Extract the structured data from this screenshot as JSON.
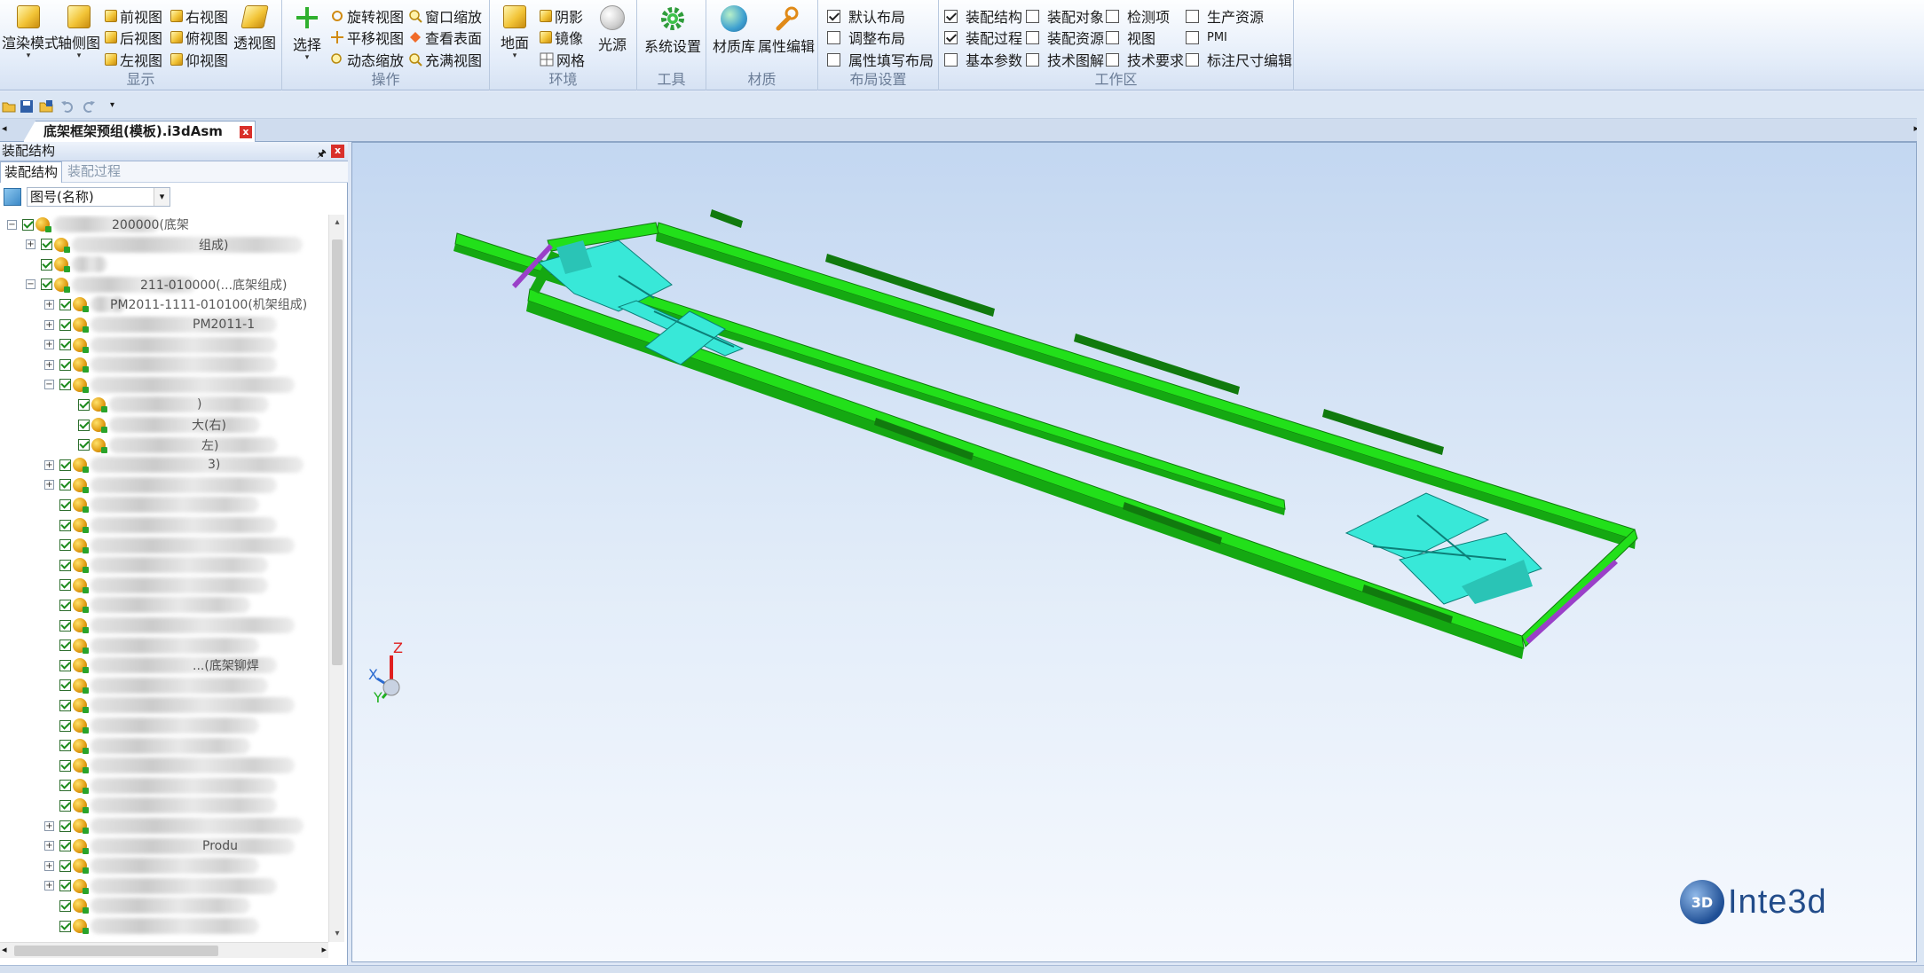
{
  "ribbon": {
    "display": {
      "label": "显示",
      "render_mode": "渲染模式",
      "axis_view": "轴侧图",
      "front_view": "前视图",
      "back_view": "后视图",
      "left_view": "左视图",
      "right_view": "右视图",
      "top_view": "俯视图",
      "bottom_view": "仰视图",
      "perspective_view": "透视图"
    },
    "operation": {
      "label": "操作",
      "select": "选择",
      "rotate_view": "旋转视图",
      "pan_view": "平移视图",
      "dynamic_zoom": "动态缩放",
      "window_zoom": "窗口缩放",
      "view_surface": "查看表面",
      "fit_view": "充满视图"
    },
    "environment": {
      "label": "环境",
      "ground": "地面",
      "shadow": "阴影",
      "mirror": "镜像",
      "grid": "网格",
      "light": "光源"
    },
    "tools": {
      "label": "工具",
      "system_settings": "系统设置"
    },
    "material": {
      "label": "材质",
      "material_library": "材质库",
      "property_editor": "属性编辑"
    },
    "layout": {
      "label": "布局设置",
      "items": [
        {
          "label": "默认布局",
          "checked": true
        },
        {
          "label": "调整布局",
          "checked": false
        },
        {
          "label": "属性填写布局",
          "checked": false
        }
      ]
    },
    "workspace": {
      "label": "工作区",
      "col1": [
        {
          "label": "装配结构",
          "checked": true
        },
        {
          "label": "装配过程",
          "checked": true
        },
        {
          "label": "基本参数",
          "checked": false
        }
      ],
      "col2": [
        {
          "label": "装配对象",
          "checked": false
        },
        {
          "label": "装配资源",
          "checked": false
        },
        {
          "label": "技术图解",
          "checked": false
        }
      ],
      "col3": [
        {
          "label": "检测项",
          "checked": false
        },
        {
          "label": "视图",
          "checked": false
        },
        {
          "label": "技术要求",
          "checked": false
        }
      ],
      "col4": [
        {
          "label": "生产资源",
          "checked": false
        },
        {
          "label": "PMI",
          "checked": false
        },
        {
          "label": "标注尺寸编辑",
          "checked": false
        }
      ]
    }
  },
  "doc_tab": {
    "title": "底架框架预组(模板).i3dAsm",
    "close": "x"
  },
  "panel": {
    "title": "装配结构",
    "pin": "ᵖ",
    "close": "x",
    "tabs": [
      "装配结构",
      "装配过程"
    ],
    "filter_value": "图号(名称)",
    "tree_visible": [
      {
        "row": 0,
        "text": "200000(底架"
      },
      {
        "row": 1,
        "text": "组成)"
      },
      {
        "row": 3,
        "text": "211-010000(...底架组成)"
      },
      {
        "row": 4,
        "text": "PM2011-1111-010100(机架组成)"
      },
      {
        "row": 5,
        "text": "PM2011-1"
      },
      {
        "row": 9,
        "text": ")"
      },
      {
        "row": 10,
        "text": "大(右)"
      },
      {
        "row": 11,
        "text": "左)"
      },
      {
        "row": 12,
        "text": "3)"
      },
      {
        "row": 22,
        "text": "...(底架铆焊"
      },
      {
        "row": 31,
        "text": "Produ"
      }
    ]
  },
  "viewport": {
    "axis_x": "X",
    "axis_y": "Y",
    "axis_z": "Z",
    "logo_text": "Inte3d",
    "logo_mark": "3D"
  },
  "colors": {
    "frame_green": "#22e01a",
    "frame_dark": "#117a0e",
    "subframe_cyan": "#38e8d8",
    "end_purple": "#9a40c8"
  }
}
